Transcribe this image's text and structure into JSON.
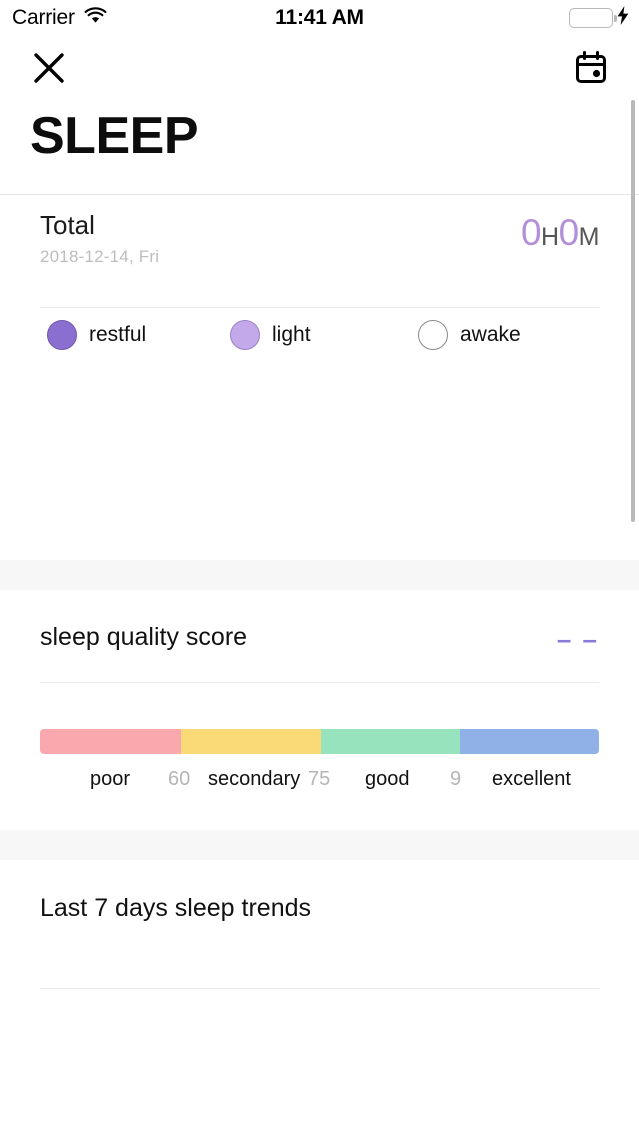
{
  "status_bar": {
    "carrier": "Carrier",
    "wifi_icon": "wifi-icon",
    "time": "11:41 AM",
    "battery_icon": "battery-full-icon",
    "charging_icon": "lightning-bolt-icon"
  },
  "nav": {
    "close_icon": "close-icon",
    "calendar_icon": "calendar-icon"
  },
  "header": {
    "title": "SLEEP"
  },
  "total": {
    "label": "Total",
    "date": "2018-12-14, Fri",
    "hours": "0",
    "hours_unit": "H",
    "minutes": "0",
    "minutes_unit": "M",
    "value_color": "#b38fd9"
  },
  "legend": {
    "items": [
      {
        "label": "restful",
        "color": "#8a6fd0"
      },
      {
        "label": "light",
        "color": "#c3a8ea"
      },
      {
        "label": "awake",
        "color": "#ffffff"
      }
    ]
  },
  "quality": {
    "title": "sleep quality score",
    "value": "– –",
    "value_color": "#8b7bd8",
    "scale": {
      "segments": [
        {
          "label": "poor",
          "color": "#f9a8ae"
        },
        {
          "label": "secondary",
          "color": "#fada77"
        },
        {
          "label": "good",
          "color": "#97e3bd"
        },
        {
          "label": "excellent",
          "color": "#8fb1e8"
        }
      ],
      "ticks": [
        "60",
        "75",
        "9"
      ]
    }
  },
  "trends": {
    "title": "Last 7 days sleep trends"
  },
  "chart_data": {
    "type": "bar",
    "title": "sleep quality score scale",
    "categories": [
      "poor",
      "secondary",
      "good",
      "excellent"
    ],
    "values": [
      0,
      60,
      75,
      90
    ],
    "colors": [
      "#f9a8ae",
      "#fada77",
      "#97e3bd",
      "#8fb1e8"
    ],
    "boundaries": [
      "60",
      "75",
      "9"
    ],
    "xlabel": "",
    "ylabel": "",
    "legend": "none",
    "grid": false
  }
}
